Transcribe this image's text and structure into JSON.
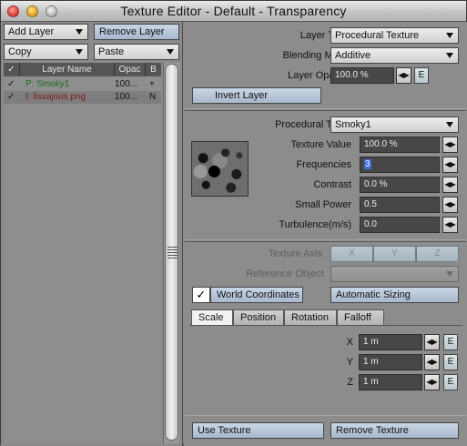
{
  "window": {
    "title": "Texture Editor - Default - Transparency"
  },
  "left": {
    "add_layer": "Add Layer",
    "remove_layer": "Remove Layer",
    "copy": "Copy",
    "paste": "Paste",
    "columns": [
      "✓",
      "Layer Name",
      "Opac",
      "B"
    ],
    "layers": [
      {
        "check": "✓",
        "name": "P: Smoky1",
        "opacity": "100...",
        "blend": "+",
        "color": "#1e6e1e"
      },
      {
        "check": "✓",
        "name": "I: lissajous.png",
        "opacity": "100...",
        "blend": "N",
        "color": "#7a1a1a"
      }
    ]
  },
  "layer": {
    "type_label": "Layer Type",
    "type_value": "Procedural Texture",
    "blend_label": "Blending Mode",
    "blend_value": "Additive",
    "opacity_label": "Layer Opacity",
    "opacity_value": "100.0 %",
    "invert_label": "Invert Layer"
  },
  "procedural": {
    "type_label": "Procedural Type",
    "type_value": "Smoky1",
    "params": [
      {
        "label": "Texture Value",
        "value": "100.0 %"
      },
      {
        "label": "Frequencies",
        "value": "3"
      },
      {
        "label": "Contrast",
        "value": "0.0 %"
      },
      {
        "label": "Small Power",
        "value": "0.5"
      },
      {
        "label": "Turbulence(m/s)",
        "value": "0.0"
      }
    ]
  },
  "mapping": {
    "axis_label": "Texture Axis",
    "axes": [
      "X",
      "Y",
      "Z"
    ],
    "ref_label": "Reference Object",
    "world_coords": "World Coordinates",
    "world_checked": "✓",
    "auto_sizing": "Automatic Sizing",
    "tabs": [
      "Scale",
      "Position",
      "Rotation",
      "Falloff"
    ],
    "active_tab": "Scale",
    "scale": [
      {
        "axis": "X",
        "value": "1 m"
      },
      {
        "axis": "Y",
        "value": "1 m"
      },
      {
        "axis": "Z",
        "value": "1 m"
      }
    ]
  },
  "footer": {
    "use_texture": "Use Texture",
    "remove_texture": "Remove Texture"
  },
  "icons": {
    "spin": "◀▶",
    "envelope": "E"
  }
}
